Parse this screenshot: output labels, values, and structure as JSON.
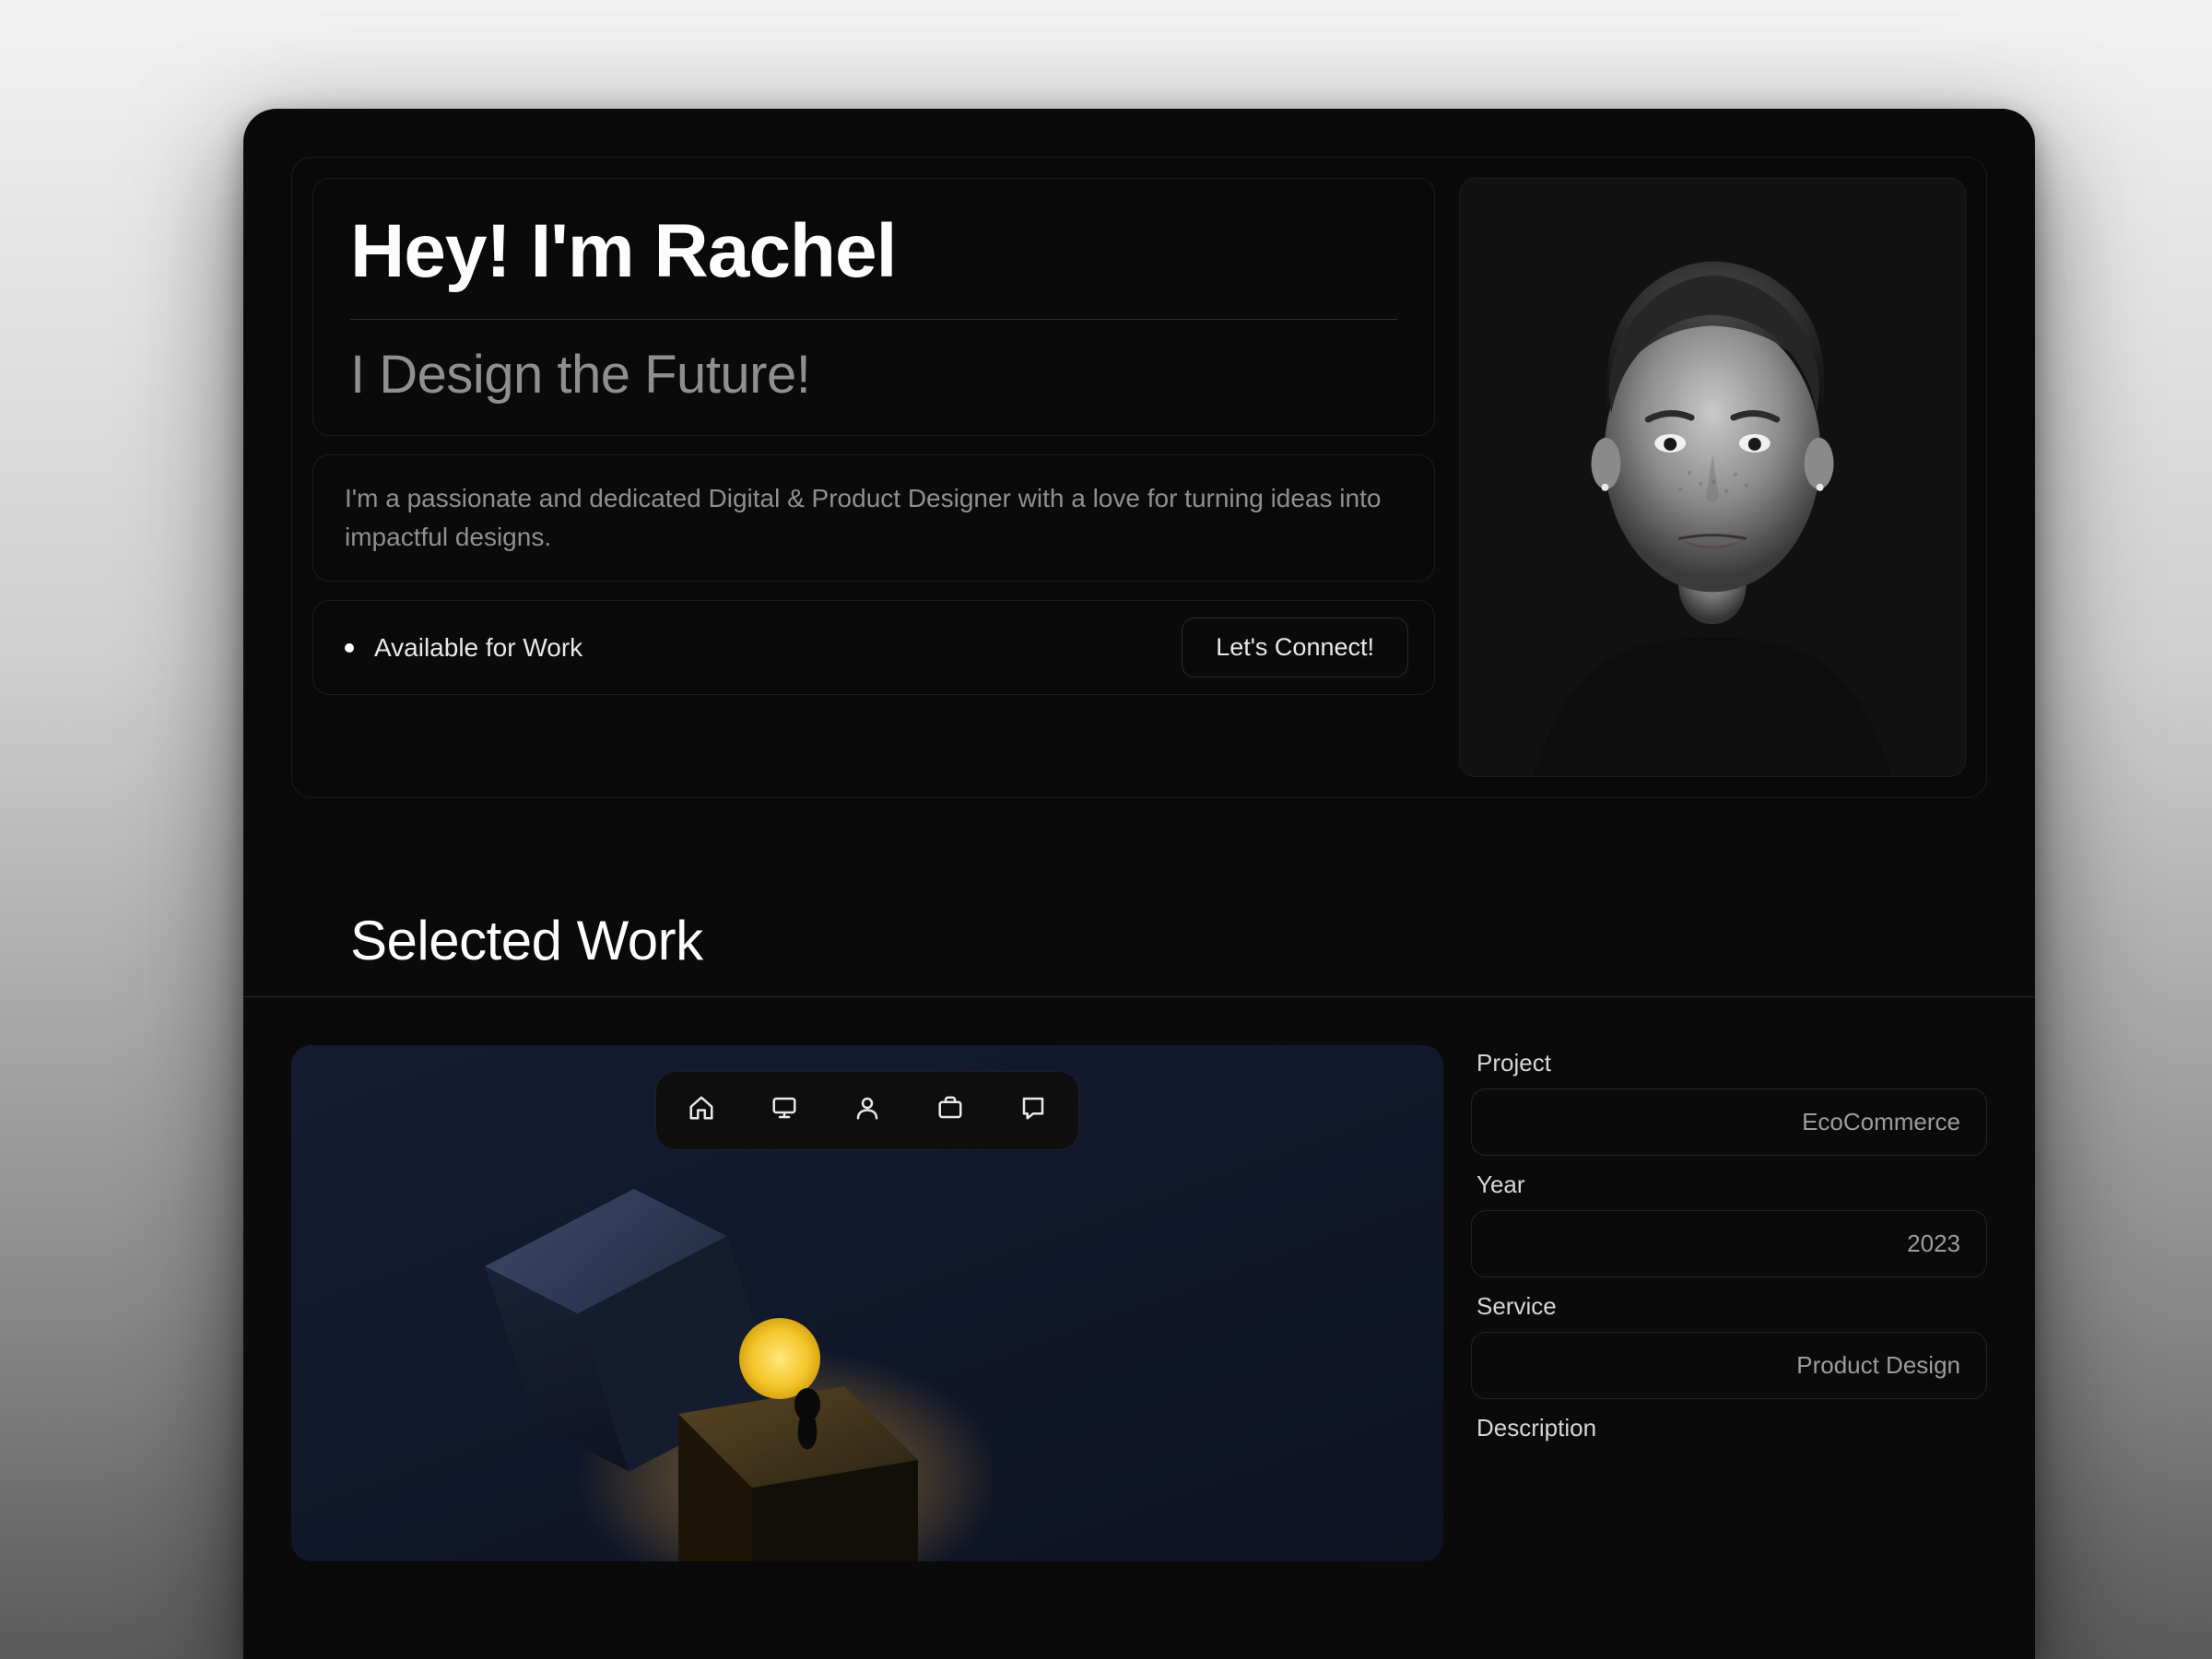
{
  "hero": {
    "title": "Hey! I'm Rachel",
    "subtitle": "I Design the Future!",
    "bio": "I'm a passionate and dedicated Digital & Product Designer with a love for turning ideas into impactful designs.",
    "availability": "Available for Work",
    "connect_label": "Let's Connect!"
  },
  "nav_icons": [
    "home",
    "monitor",
    "user",
    "briefcase",
    "message"
  ],
  "section": {
    "selected_work_title": "Selected Work"
  },
  "project": {
    "labels": {
      "project": "Project",
      "year": "Year",
      "service": "Service",
      "description": "Description"
    },
    "name": "EcoCommerce",
    "year": "2023",
    "service": "Product Design"
  },
  "colors": {
    "bg": "#0a0a0a",
    "border": "#1d1d1d",
    "text_muted": "#8f8f8f",
    "accent_yellow": "#f4d23a"
  }
}
